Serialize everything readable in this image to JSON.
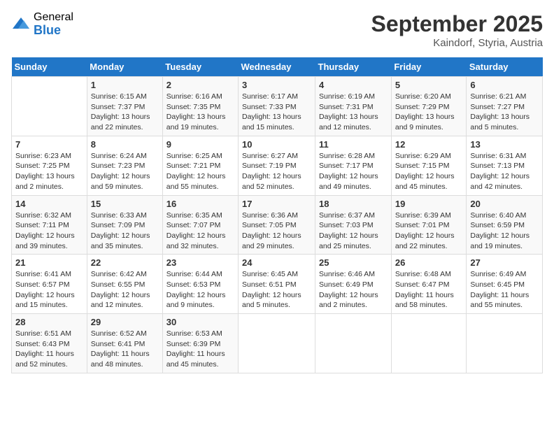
{
  "logo": {
    "general": "General",
    "blue": "Blue"
  },
  "title": "September 2025",
  "location": "Kaindorf, Styria, Austria",
  "days_of_week": [
    "Sunday",
    "Monday",
    "Tuesday",
    "Wednesday",
    "Thursday",
    "Friday",
    "Saturday"
  ],
  "weeks": [
    [
      {
        "day": "",
        "detail": ""
      },
      {
        "day": "1",
        "detail": "Sunrise: 6:15 AM\nSunset: 7:37 PM\nDaylight: 13 hours\nand 22 minutes."
      },
      {
        "day": "2",
        "detail": "Sunrise: 6:16 AM\nSunset: 7:35 PM\nDaylight: 13 hours\nand 19 minutes."
      },
      {
        "day": "3",
        "detail": "Sunrise: 6:17 AM\nSunset: 7:33 PM\nDaylight: 13 hours\nand 15 minutes."
      },
      {
        "day": "4",
        "detail": "Sunrise: 6:19 AM\nSunset: 7:31 PM\nDaylight: 13 hours\nand 12 minutes."
      },
      {
        "day": "5",
        "detail": "Sunrise: 6:20 AM\nSunset: 7:29 PM\nDaylight: 13 hours\nand 9 minutes."
      },
      {
        "day": "6",
        "detail": "Sunrise: 6:21 AM\nSunset: 7:27 PM\nDaylight: 13 hours\nand 5 minutes."
      }
    ],
    [
      {
        "day": "7",
        "detail": "Sunrise: 6:23 AM\nSunset: 7:25 PM\nDaylight: 13 hours\nand 2 minutes."
      },
      {
        "day": "8",
        "detail": "Sunrise: 6:24 AM\nSunset: 7:23 PM\nDaylight: 12 hours\nand 59 minutes."
      },
      {
        "day": "9",
        "detail": "Sunrise: 6:25 AM\nSunset: 7:21 PM\nDaylight: 12 hours\nand 55 minutes."
      },
      {
        "day": "10",
        "detail": "Sunrise: 6:27 AM\nSunset: 7:19 PM\nDaylight: 12 hours\nand 52 minutes."
      },
      {
        "day": "11",
        "detail": "Sunrise: 6:28 AM\nSunset: 7:17 PM\nDaylight: 12 hours\nand 49 minutes."
      },
      {
        "day": "12",
        "detail": "Sunrise: 6:29 AM\nSunset: 7:15 PM\nDaylight: 12 hours\nand 45 minutes."
      },
      {
        "day": "13",
        "detail": "Sunrise: 6:31 AM\nSunset: 7:13 PM\nDaylight: 12 hours\nand 42 minutes."
      }
    ],
    [
      {
        "day": "14",
        "detail": "Sunrise: 6:32 AM\nSunset: 7:11 PM\nDaylight: 12 hours\nand 39 minutes."
      },
      {
        "day": "15",
        "detail": "Sunrise: 6:33 AM\nSunset: 7:09 PM\nDaylight: 12 hours\nand 35 minutes."
      },
      {
        "day": "16",
        "detail": "Sunrise: 6:35 AM\nSunset: 7:07 PM\nDaylight: 12 hours\nand 32 minutes."
      },
      {
        "day": "17",
        "detail": "Sunrise: 6:36 AM\nSunset: 7:05 PM\nDaylight: 12 hours\nand 29 minutes."
      },
      {
        "day": "18",
        "detail": "Sunrise: 6:37 AM\nSunset: 7:03 PM\nDaylight: 12 hours\nand 25 minutes."
      },
      {
        "day": "19",
        "detail": "Sunrise: 6:39 AM\nSunset: 7:01 PM\nDaylight: 12 hours\nand 22 minutes."
      },
      {
        "day": "20",
        "detail": "Sunrise: 6:40 AM\nSunset: 6:59 PM\nDaylight: 12 hours\nand 19 minutes."
      }
    ],
    [
      {
        "day": "21",
        "detail": "Sunrise: 6:41 AM\nSunset: 6:57 PM\nDaylight: 12 hours\nand 15 minutes."
      },
      {
        "day": "22",
        "detail": "Sunrise: 6:42 AM\nSunset: 6:55 PM\nDaylight: 12 hours\nand 12 minutes."
      },
      {
        "day": "23",
        "detail": "Sunrise: 6:44 AM\nSunset: 6:53 PM\nDaylight: 12 hours\nand 9 minutes."
      },
      {
        "day": "24",
        "detail": "Sunrise: 6:45 AM\nSunset: 6:51 PM\nDaylight: 12 hours\nand 5 minutes."
      },
      {
        "day": "25",
        "detail": "Sunrise: 6:46 AM\nSunset: 6:49 PM\nDaylight: 12 hours\nand 2 minutes."
      },
      {
        "day": "26",
        "detail": "Sunrise: 6:48 AM\nSunset: 6:47 PM\nDaylight: 11 hours\nand 58 minutes."
      },
      {
        "day": "27",
        "detail": "Sunrise: 6:49 AM\nSunset: 6:45 PM\nDaylight: 11 hours\nand 55 minutes."
      }
    ],
    [
      {
        "day": "28",
        "detail": "Sunrise: 6:51 AM\nSunset: 6:43 PM\nDaylight: 11 hours\nand 52 minutes."
      },
      {
        "day": "29",
        "detail": "Sunrise: 6:52 AM\nSunset: 6:41 PM\nDaylight: 11 hours\nand 48 minutes."
      },
      {
        "day": "30",
        "detail": "Sunrise: 6:53 AM\nSunset: 6:39 PM\nDaylight: 11 hours\nand 45 minutes."
      },
      {
        "day": "",
        "detail": ""
      },
      {
        "day": "",
        "detail": ""
      },
      {
        "day": "",
        "detail": ""
      },
      {
        "day": "",
        "detail": ""
      }
    ]
  ]
}
